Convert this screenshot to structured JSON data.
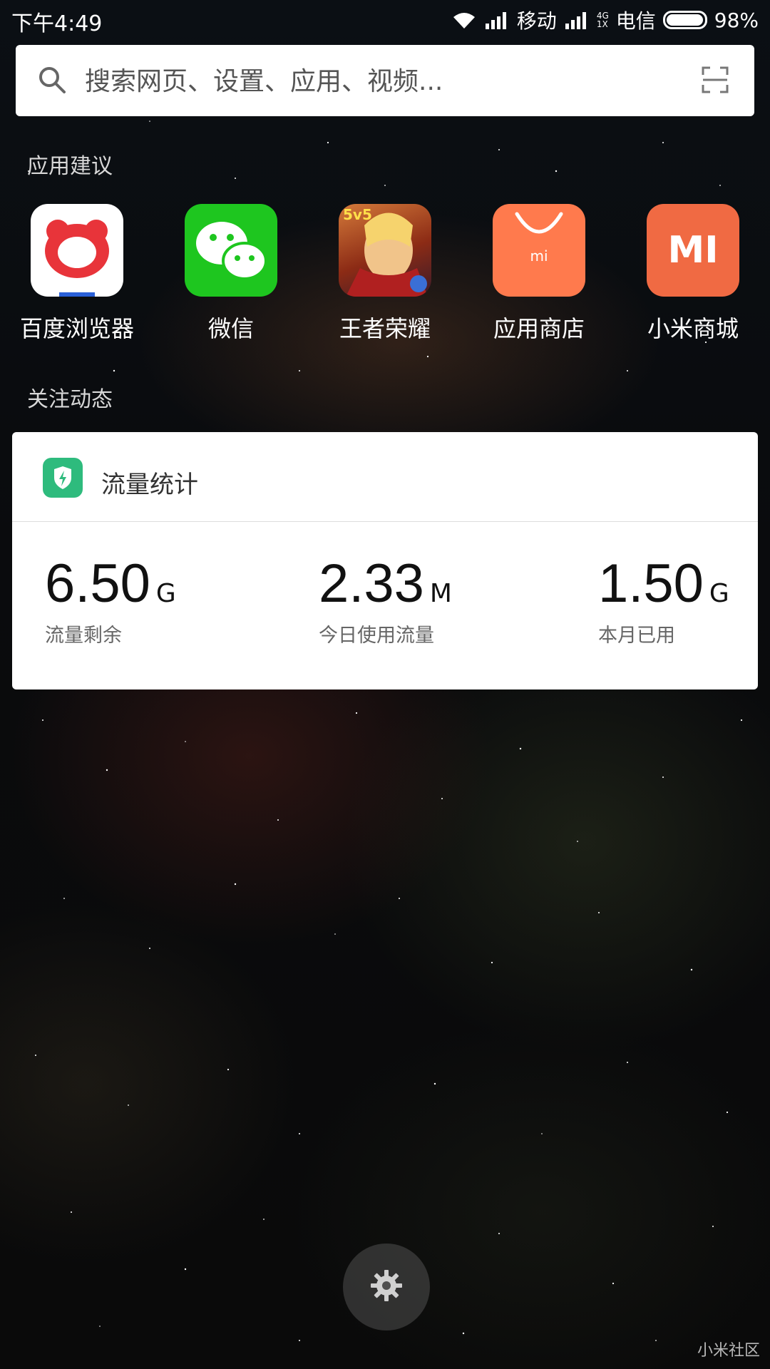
{
  "status_bar": {
    "time": "下午4:49",
    "carrier_1": "移动",
    "carrier_2": "电信",
    "network_type_top": "4G",
    "network_type_bottom": "1X",
    "battery_percent_text": "98%",
    "battery_level": 0.98
  },
  "search": {
    "placeholder": "搜索网页、设置、应用、视频..."
  },
  "apps_section": {
    "title": "应用建议",
    "apps": [
      {
        "label": "百度浏览器",
        "icon": "baidu-browser-icon",
        "color": "#ffffff",
        "accent": "#e8343a"
      },
      {
        "label": "微信",
        "icon": "wechat-icon",
        "color": "#1ec61f"
      },
      {
        "label": "王者荣耀",
        "icon": "honor-of-kings-icon",
        "badge_text": "5v5",
        "color": "#b64b22"
      },
      {
        "label": "应用商店",
        "icon": "app-store-icon",
        "badge_text": "mi",
        "color": "#ff7a4d"
      },
      {
        "label": "小米商城",
        "icon": "mi-store-icon",
        "badge_text": "MI",
        "color": "#f06a43"
      }
    ]
  },
  "follow_section": {
    "title": "关注动态"
  },
  "data_card": {
    "title": "流量统计",
    "icon": "shield-lightning-icon",
    "icon_color": "#2ebb7d",
    "stats": [
      {
        "value": "6.50",
        "unit": "G",
        "label": "流量剩余"
      },
      {
        "value": "2.33",
        "unit": "M",
        "label": "今日使用流量"
      },
      {
        "value": "1.50",
        "unit": "G",
        "label": "本月已用"
      }
    ]
  },
  "settings": {
    "icon": "gear-icon"
  },
  "watermark": "小米社区"
}
